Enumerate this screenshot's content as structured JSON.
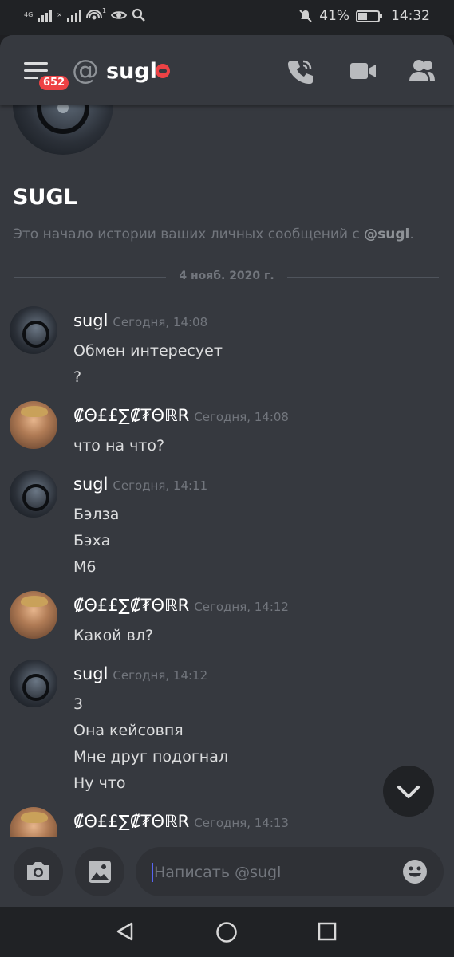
{
  "status_bar": {
    "network_small_1": "4G",
    "network_small_2": "×",
    "hotspot_count": "1",
    "battery_percent": "41%",
    "time": "14:32",
    "icons": [
      "signal-icon",
      "wifi-hotspot-icon",
      "eye-icon",
      "search-icon",
      "mute-icon",
      "battery-icon"
    ]
  },
  "header": {
    "unread_badge": "652",
    "at_symbol": "@",
    "channel_name": "sugl",
    "status": "do-not-disturb",
    "icons": [
      "menu-icon",
      "call-icon",
      "video-icon",
      "members-icon"
    ]
  },
  "intro": {
    "title": "SUGL",
    "text_prefix": "Это начало истории ваших личных сообщений с ",
    "mention": "@sugl",
    "text_suffix": "."
  },
  "date_divider": "4 нояб. 2020 г.",
  "messages": [
    {
      "author": "sugl",
      "time": "Сегодня, 14:08",
      "lines": [
        "Обмен интересует",
        "?"
      ]
    },
    {
      "author": "₡Θ££∑₡₮ΘℝR",
      "time": "Сегодня, 14:08",
      "lines": [
        "что на что?"
      ]
    },
    {
      "author": "sugl",
      "time": "Сегодня, 14:11",
      "lines": [
        "Бэлза",
        "Бэха",
        "М6"
      ]
    },
    {
      "author": "₡Θ££∑₡₮ΘℝR",
      "time": "Сегодня, 14:12",
      "lines": [
        "Какой вл?"
      ]
    },
    {
      "author": "sugl",
      "time": "Сегодня, 14:12",
      "lines": [
        "3",
        "Она кейсовпя",
        "Мне друг подогнал",
        "Ну что"
      ]
    },
    {
      "author": "₡Θ££∑₡₮ΘℝR",
      "time": "Сегодня, 14:13",
      "lines": []
    }
  ],
  "composer": {
    "placeholder": "Написать @sugl",
    "icons": [
      "camera-icon",
      "image-icon",
      "emoji-icon"
    ]
  },
  "nav": {
    "icons": [
      "back-icon",
      "home-icon",
      "recents-icon"
    ]
  },
  "colors": {
    "background": "#36393f",
    "dark": "#202225",
    "accent_red": "#ed4245",
    "muted_text": "#72767d",
    "text": "#dcddde",
    "cursor": "#5865f2"
  }
}
